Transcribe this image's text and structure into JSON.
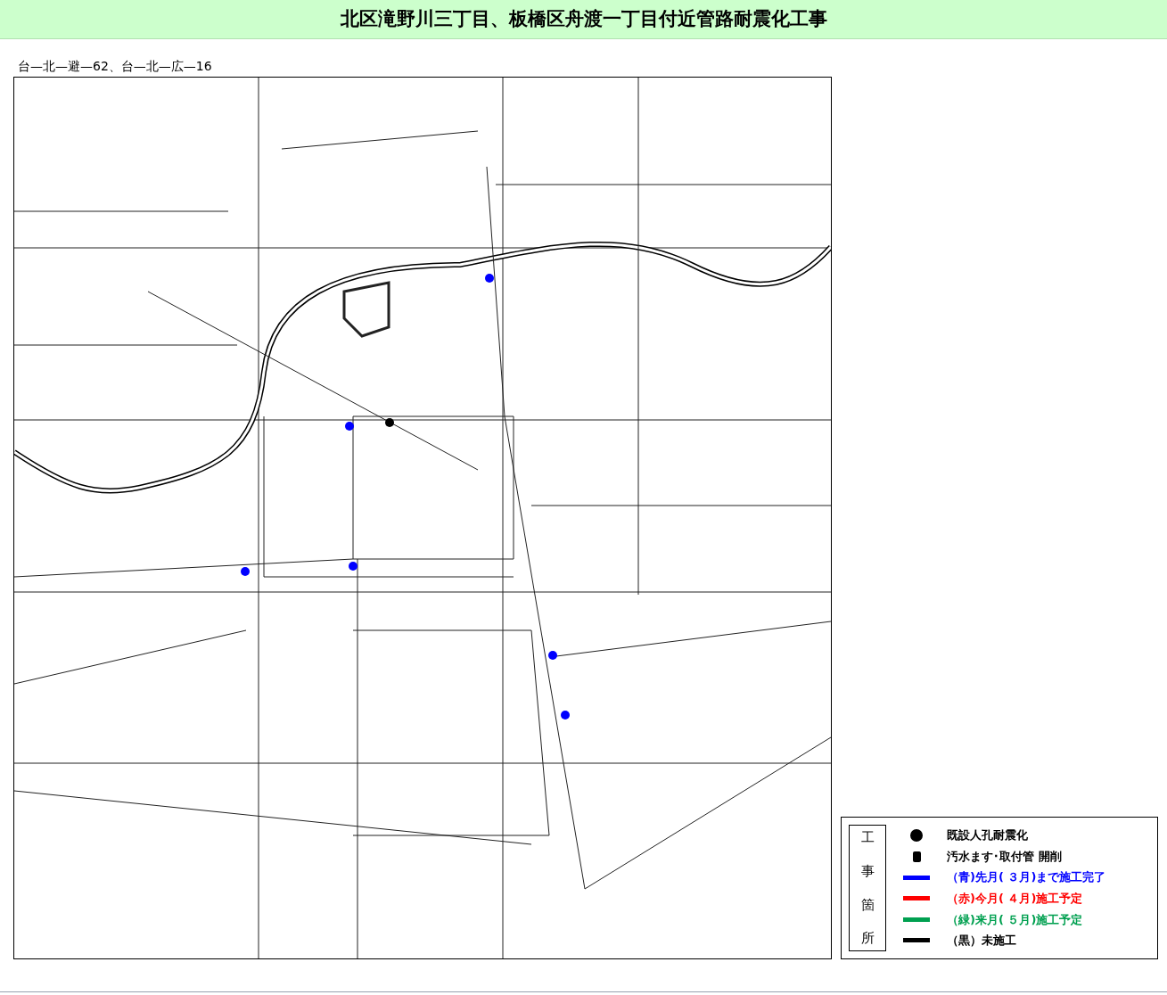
{
  "header": {
    "title": "北区滝野川三丁目、板橋区舟渡一丁目付近管路耐震化工事"
  },
  "subtitle": "台—北—避—62、台—北—広—16",
  "legend": {
    "heading": [
      "工",
      "事",
      "箇",
      "所"
    ],
    "items": [
      {
        "kind": "dot",
        "label": "既設人孔耐震化",
        "color": "#000000"
      },
      {
        "kind": "square",
        "label": "汚水ます･取付管 開削",
        "color": "#000000"
      },
      {
        "kind": "line",
        "label": "（青)先月( ３月)まで施工完了",
        "color": "#0000ff"
      },
      {
        "kind": "line",
        "label": "（赤)今月( ４月)施工予定",
        "color": "#ff0000"
      },
      {
        "kind": "line",
        "label": "（緑)来月( ５月)施工予定",
        "color": "#00a050"
      },
      {
        "kind": "line",
        "label": "（黒）未施工",
        "color": "#000000"
      }
    ]
  }
}
